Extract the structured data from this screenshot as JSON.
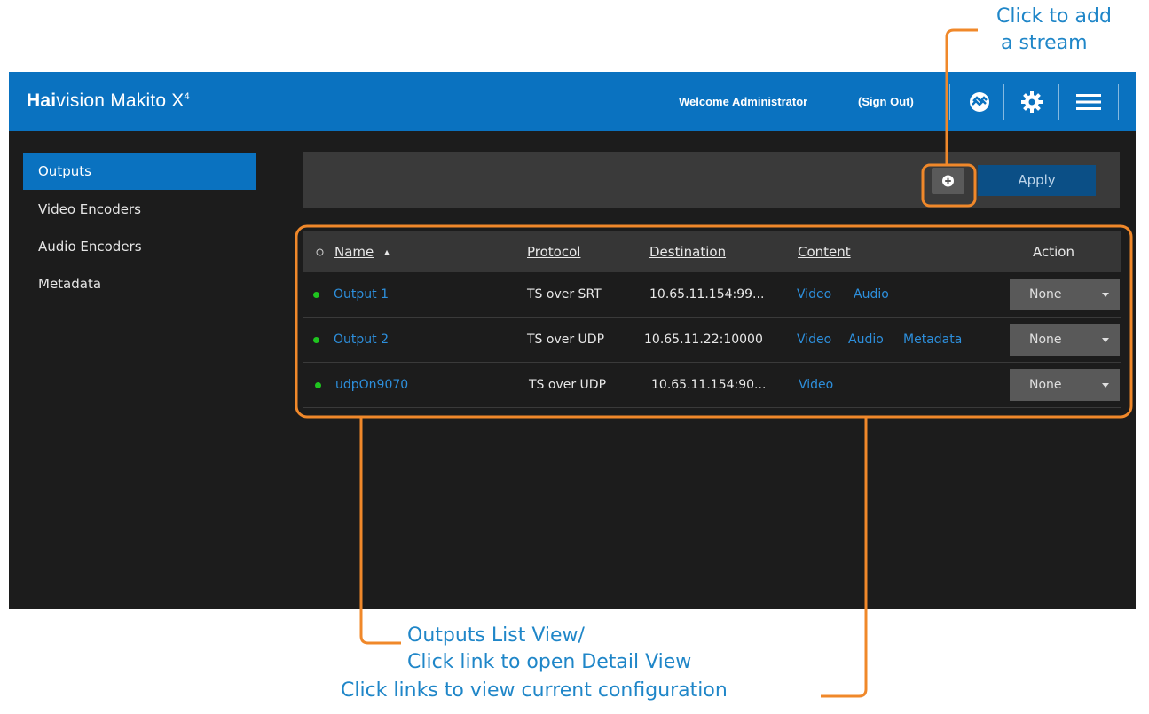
{
  "callouts": {
    "add_stream_line1": "Click to add",
    "add_stream_line2": "a stream",
    "list_view_line1": "Outputs List View/",
    "list_view_line2": "Click link to open Detail View",
    "links_config": "Click links to view current configuration"
  },
  "header": {
    "brand_bold": "Hai",
    "brand_rest": "vision Makito X",
    "brand_sup": "4",
    "welcome": "Welcome Administrator",
    "sign_out": "(Sign Out)",
    "icons": [
      "haivision-logo-icon",
      "gear-icon",
      "hamburger-menu-icon"
    ]
  },
  "sidebar": {
    "items": [
      {
        "label": "Outputs",
        "active": true
      },
      {
        "label": "Video Encoders",
        "active": false
      },
      {
        "label": "Audio Encoders",
        "active": false
      },
      {
        "label": "Metadata",
        "active": false
      }
    ]
  },
  "toolbar": {
    "add_icon": "plus-circle-icon",
    "apply_label": "Apply"
  },
  "table": {
    "columns": {
      "name": "Name",
      "protocol": "Protocol",
      "destination": "Destination",
      "content": "Content",
      "action": "Action"
    },
    "sort_indicator": "▴",
    "rows": [
      {
        "status": "active",
        "name": "Output 1",
        "protocol": "TS over SRT",
        "destination": "10.65.11.154:99...",
        "content": [
          "Video",
          "Audio"
        ],
        "action": "None"
      },
      {
        "status": "active",
        "name": "Output 2",
        "protocol": "TS over UDP",
        "destination": "10.65.11.22:10000",
        "content": [
          "Video",
          "Audio",
          "Metadata"
        ],
        "action": "None"
      },
      {
        "status": "active",
        "name": "udpOn9070",
        "protocol": "TS over UDP",
        "destination": "10.65.11.154:90...",
        "content": [
          "Video"
        ],
        "action": "None"
      }
    ]
  },
  "colors": {
    "brand_blue": "#0a72c0",
    "link_blue": "#2d8fdc",
    "status_green": "#1fc41f",
    "callout_orange": "#f0882a",
    "callout_text": "#1f86c8"
  }
}
